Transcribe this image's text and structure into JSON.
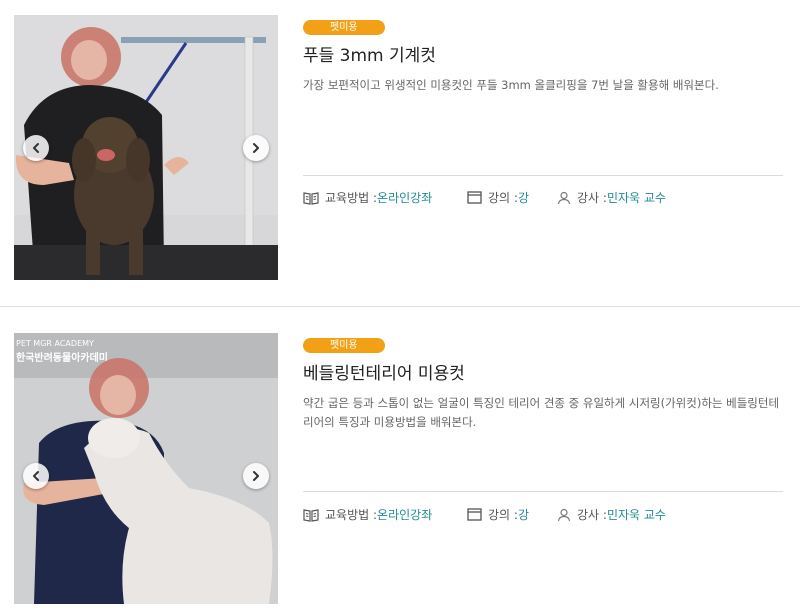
{
  "courses": [
    {
      "badge": "펫미용",
      "title": "푸들 3mm 기계컷",
      "description": "가장 보편적이고 위생적인 미용컷인 푸들 3mm 올클리핑을 7번 날을 활용해 배워본다.",
      "method_label": "교육방법 : ",
      "method_value": "온라인강좌",
      "lecture_label": "강의 : ",
      "lecture_value": "강",
      "instructor_label": "강사 : ",
      "instructor_value": "민자욱 교수",
      "image_alt": "푸들 3mm 기계컷 강의 썸네일"
    },
    {
      "badge": "펫미용",
      "title": "베들링턴테리어 미용컷",
      "description": "약간 굽은 등과 스톱이 없는 얼굴이 특징인 테리어 견종 중 유일하게 시저링(가위컷)하는 베들링턴테리어의 특징과 미용방법을 배워본다.",
      "method_label": "교육방법 : ",
      "method_value": "온라인강좌",
      "lecture_label": "강의 : ",
      "lecture_value": "강",
      "instructor_label": "강사 : ",
      "instructor_value": "민자욱 교수",
      "image_alt": "베들링턴테리어 미용컷 강의 썸네일",
      "image_watermark_top": "PET MGR ACADEMY",
      "image_watermark": "한국반려동물아카데미"
    }
  ],
  "icons": {
    "prev": "chevron-left-icon",
    "next": "chevron-right-icon",
    "method": "book-open-icon",
    "lecture": "window-icon",
    "instructor": "person-icon"
  },
  "colors": {
    "badge": "#f2a015",
    "link": "#1e8c96",
    "divider": "#dcdcdc"
  }
}
